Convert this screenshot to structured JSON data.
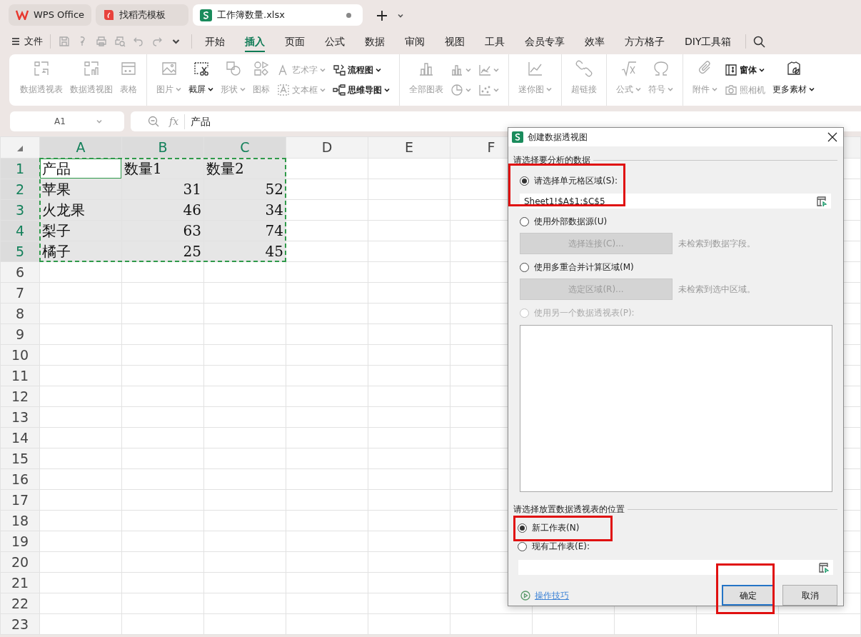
{
  "app_tabs": [
    {
      "kind": "wps",
      "title": "WPS Office",
      "selected": false,
      "unsaved": false
    },
    {
      "kind": "template",
      "title": "找稻壳模板",
      "selected": false,
      "unsaved": false
    },
    {
      "kind": "sheet",
      "title": "工作簿数量.xlsx",
      "selected": true,
      "unsaved": true
    }
  ],
  "file_menu": "文件",
  "ribbon_tabs": [
    {
      "label": "开始",
      "selected": false
    },
    {
      "label": "插入",
      "selected": true
    },
    {
      "label": "页面",
      "selected": false
    },
    {
      "label": "公式",
      "selected": false
    },
    {
      "label": "数据",
      "selected": false
    },
    {
      "label": "审阅",
      "selected": false
    },
    {
      "label": "视图",
      "selected": false
    },
    {
      "label": "工具",
      "selected": false
    },
    {
      "label": "会员专享",
      "selected": false
    },
    {
      "label": "效率",
      "selected": false
    },
    {
      "label": "方方格子",
      "selected": false
    },
    {
      "label": "DIY工具箱",
      "selected": false
    }
  ],
  "ribbon_groups": [
    {
      "items": [
        {
          "kind": "large",
          "label": "数据透视表",
          "disabled": true,
          "dropdown": false
        },
        {
          "kind": "large",
          "label": "数据透视图",
          "disabled": true,
          "dropdown": false
        },
        {
          "kind": "large",
          "label": "表格",
          "disabled": true,
          "dropdown": false
        }
      ]
    },
    {
      "items": [
        {
          "kind": "large",
          "label": "图片",
          "disabled": true,
          "dropdown": true
        },
        {
          "kind": "large",
          "label": "截屏",
          "disabled": false,
          "dropdown": true
        },
        {
          "kind": "large",
          "label": "形状",
          "disabled": true,
          "dropdown": true
        },
        {
          "kind": "large",
          "label": "图标",
          "disabled": true,
          "dropdown": false
        },
        {
          "kind": "stack",
          "items": [
            {
              "kind": "small",
              "label": "艺术字",
              "disabled": true,
              "dropdown": true
            },
            {
              "kind": "small",
              "label": "文本框",
              "disabled": true,
              "dropdown": true
            }
          ]
        },
        {
          "kind": "stack",
          "items": [
            {
              "kind": "small",
              "label": "流程图",
              "disabled": false,
              "dropdown": true
            },
            {
              "kind": "small",
              "label": "思维导图",
              "disabled": false,
              "dropdown": true
            }
          ]
        }
      ]
    },
    {
      "items": [
        {
          "kind": "large",
          "label": "全部图表",
          "disabled": true,
          "dropdown": false
        },
        {
          "kind": "stack",
          "items": [
            {
              "kind": "icon",
              "disabled": true,
              "dropdown": true
            },
            {
              "kind": "icon",
              "disabled": true,
              "dropdown": true
            }
          ]
        },
        {
          "kind": "stack",
          "items": [
            {
              "kind": "icon",
              "disabled": true,
              "dropdown": true
            },
            {
              "kind": "icon",
              "disabled": true,
              "dropdown": true
            }
          ]
        }
      ]
    },
    {
      "items": [
        {
          "kind": "large",
          "label": "迷你图",
          "disabled": true,
          "dropdown": true
        }
      ]
    },
    {
      "items": [
        {
          "kind": "large",
          "label": "超链接",
          "disabled": true,
          "dropdown": false
        }
      ]
    },
    {
      "items": [
        {
          "kind": "large",
          "label": "公式",
          "disabled": true,
          "dropdown": true
        },
        {
          "kind": "large",
          "label": "符号",
          "disabled": true,
          "dropdown": true
        }
      ]
    },
    {
      "items": [
        {
          "kind": "large",
          "label": "附件",
          "disabled": true,
          "dropdown": true
        },
        {
          "kind": "stack",
          "items": [
            {
              "kind": "small",
              "label": "窗体",
              "disabled": false,
              "dropdown": true
            },
            {
              "kind": "small",
              "label": "照相机",
              "disabled": true,
              "dropdown": false
            }
          ]
        },
        {
          "kind": "large",
          "label": "更多素材",
          "disabled": false,
          "dropdown": true
        }
      ]
    }
  ],
  "formula_bar": {
    "cell_ref": "A1",
    "fx_label": "fx",
    "formula": "产品"
  },
  "sheet": {
    "columns": [
      {
        "label": "A",
        "selected": true
      },
      {
        "label": "B",
        "selected": true
      },
      {
        "label": "C",
        "selected": true
      },
      {
        "label": "D",
        "selected": false
      },
      {
        "label": "E",
        "selected": false
      },
      {
        "label": "F",
        "selected": false
      }
    ],
    "rows": [
      {
        "number": "1",
        "selected": true,
        "cells": [
          {
            "text": "产品",
            "kind": "text",
            "active": true
          },
          {
            "text": "数量1",
            "kind": "text",
            "active": false
          },
          {
            "text": "数量2",
            "kind": "text",
            "active": false
          }
        ]
      },
      {
        "number": "2",
        "selected": true,
        "cells": [
          {
            "text": "苹果",
            "kind": "text",
            "active": false
          },
          {
            "text": "31",
            "kind": "number",
            "active": false
          },
          {
            "text": "52",
            "kind": "number",
            "active": false
          }
        ]
      },
      {
        "number": "3",
        "selected": true,
        "cells": [
          {
            "text": "火龙果",
            "kind": "text",
            "active": false
          },
          {
            "text": "46",
            "kind": "number",
            "active": false
          },
          {
            "text": "34",
            "kind": "number",
            "active": false
          }
        ]
      },
      {
        "number": "4",
        "selected": true,
        "cells": [
          {
            "text": "梨子",
            "kind": "text",
            "active": false
          },
          {
            "text": "63",
            "kind": "number",
            "active": false
          },
          {
            "text": "74",
            "kind": "number",
            "active": false
          }
        ]
      },
      {
        "number": "5",
        "selected": true,
        "cells": [
          {
            "text": "橘子",
            "kind": "text",
            "active": false
          },
          {
            "text": "25",
            "kind": "number",
            "active": false
          },
          {
            "text": "45",
            "kind": "number",
            "active": false
          }
        ]
      },
      {
        "number": "6",
        "selected": false,
        "cells": []
      },
      {
        "number": "7",
        "selected": false,
        "cells": []
      },
      {
        "number": "8",
        "selected": false,
        "cells": []
      },
      {
        "number": "9",
        "selected": false,
        "cells": []
      },
      {
        "number": "10",
        "selected": false,
        "cells": []
      },
      {
        "number": "11",
        "selected": false,
        "cells": []
      },
      {
        "number": "12",
        "selected": false,
        "cells": []
      },
      {
        "number": "13",
        "selected": false,
        "cells": []
      },
      {
        "number": "14",
        "selected": false,
        "cells": []
      },
      {
        "number": "15",
        "selected": false,
        "cells": []
      },
      {
        "number": "16",
        "selected": false,
        "cells": []
      },
      {
        "number": "17",
        "selected": false,
        "cells": []
      },
      {
        "number": "18",
        "selected": false,
        "cells": []
      },
      {
        "number": "19",
        "selected": false,
        "cells": []
      },
      {
        "number": "20",
        "selected": false,
        "cells": []
      },
      {
        "number": "21",
        "selected": false,
        "cells": []
      },
      {
        "number": "22",
        "selected": false,
        "cells": []
      },
      {
        "number": "23",
        "selected": false,
        "cells": []
      }
    ]
  },
  "dialog": {
    "title": "创建数据透视图",
    "source_legend": "请选择要分析的数据",
    "source_options": [
      {
        "kind": "range",
        "label": "请选择单元格区域(S):",
        "selected": true,
        "disabled": false,
        "highlighted": true,
        "value": "Sheet1!$A$1:$C$5"
      },
      {
        "kind": "button",
        "label": "使用外部数据源(U)",
        "selected": false,
        "disabled": false,
        "highlighted": false,
        "button": {
          "label": "选择连接(C)...",
          "disabled": true
        },
        "note": "未检索到数据字段。"
      },
      {
        "kind": "button",
        "label": "使用多重合并计算区域(M)",
        "selected": false,
        "disabled": false,
        "highlighted": false,
        "button": {
          "label": "选定区域(R)...",
          "disabled": true
        },
        "note": "未检索到选中区域。"
      },
      {
        "kind": "list",
        "label": "使用另一个数据透视表(P):",
        "selected": false,
        "disabled": true,
        "highlighted": false
      }
    ],
    "place_legend": "请选择放置数据透视表的位置",
    "place_options": [
      {
        "kind": "plain",
        "label": "新工作表(N)",
        "selected": true,
        "highlighted": true
      },
      {
        "kind": "field",
        "label": "现有工作表(E):",
        "selected": false,
        "highlighted": false
      }
    ],
    "tips_link": "操作技巧",
    "buttons": [
      {
        "label": "确定",
        "default": true,
        "highlighted": true
      },
      {
        "label": "取消",
        "default": false,
        "highlighted": false
      }
    ]
  }
}
